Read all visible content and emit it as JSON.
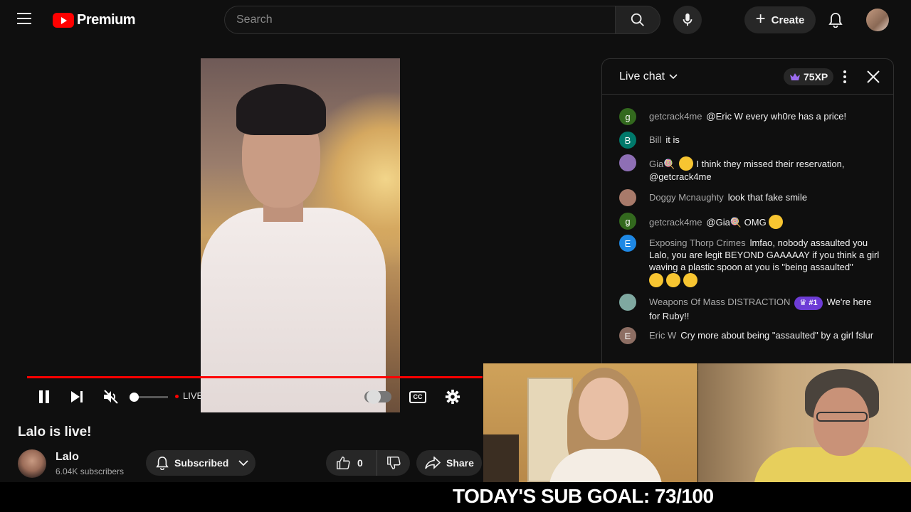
{
  "header": {
    "logo_text": "Premium",
    "search_placeholder": "Search",
    "create_label": "Create"
  },
  "player": {
    "live_label": "LIVE",
    "cc_label": "CC"
  },
  "video": {
    "title": "Lalo is live!",
    "channel_name": "Lalo",
    "subscribers": "6.04K subscribers",
    "subscribed_label": "Subscribed",
    "like_count": "0",
    "share_label": "Share"
  },
  "chat": {
    "title": "Live chat",
    "xp": "75XP",
    "messages": [
      {
        "initial": "g",
        "color": "#33691e",
        "author": "getcrack4me",
        "text": "@Eric W every wh0re has a price!"
      },
      {
        "initial": "B",
        "color": "#00796b",
        "author": "Bill",
        "text": "it is"
      },
      {
        "initial": "",
        "color": "#8e6fb5",
        "author": "Gia🍭",
        "text": "I think they missed their reservation, @getcrack4me"
      },
      {
        "initial": "",
        "color": "#a87a6a",
        "author": "Doggy Mcnaughty",
        "text": "look that fake smile"
      },
      {
        "initial": "g",
        "color": "#33691e",
        "author": "getcrack4me",
        "text": "@Gia🍭 OMG"
      },
      {
        "initial": "E",
        "color": "#1e88e5",
        "author": "Exposing Thorp Crimes",
        "text": "lmfao, nobody assaulted you Lalo, you are legit BEYOND GAAAAAY if you think a girl waving a plastic spoon at you is \"being assaulted\""
      },
      {
        "initial": "",
        "color": "#7fa8a0",
        "author": "Weapons Of Mass DISTRACTION",
        "badge": "#1",
        "text": "We're here for Ruby!!"
      },
      {
        "initial": "E",
        "color": "#8d6e63",
        "author": "Eric W",
        "text": "Cry more about being \"assaulted\" by a girl fslur"
      }
    ]
  },
  "overlay": {
    "sub_goal": "TODAY'S SUB GOAL: 73/100"
  }
}
